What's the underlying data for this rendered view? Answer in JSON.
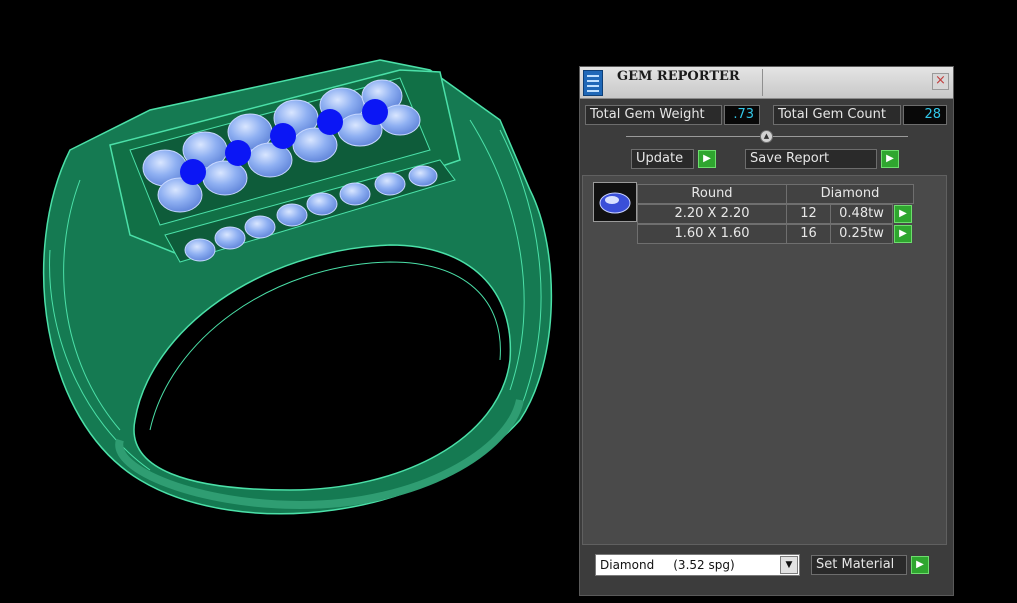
{
  "panel": {
    "title": "GEM REPORTER",
    "close_glyph": "×",
    "total_weight_label": "Total Gem Weight",
    "total_weight_value": ".73",
    "total_count_label": "Total Gem Count",
    "total_count_value": "28",
    "update_label": "Update",
    "save_report_label": "Save Report",
    "table": {
      "shape": "Round",
      "material": "Diamond",
      "rows": [
        {
          "size": "2.20 X 2.20",
          "count": "12",
          "weight": "0.48tw"
        },
        {
          "size": "1.60 X 1.60",
          "count": "16",
          "weight": "0.25tw"
        }
      ]
    },
    "material_select": "Diamond     (3.52 spg)",
    "set_material_label": "Set Material"
  },
  "icons": {
    "title": "gem-reporter-icon",
    "close": "close-icon",
    "play": "play-icon",
    "dropdown": "chevron-down-icon",
    "grip": "collapse-grip-icon"
  },
  "colors": {
    "ring": "#1a7d54",
    "wire": "#4be0a8",
    "gem_main": "#7fa7ef",
    "gem_accent": "#0b16f5",
    "value_text": "#32c7e8",
    "play_green": "#2fa62f"
  }
}
